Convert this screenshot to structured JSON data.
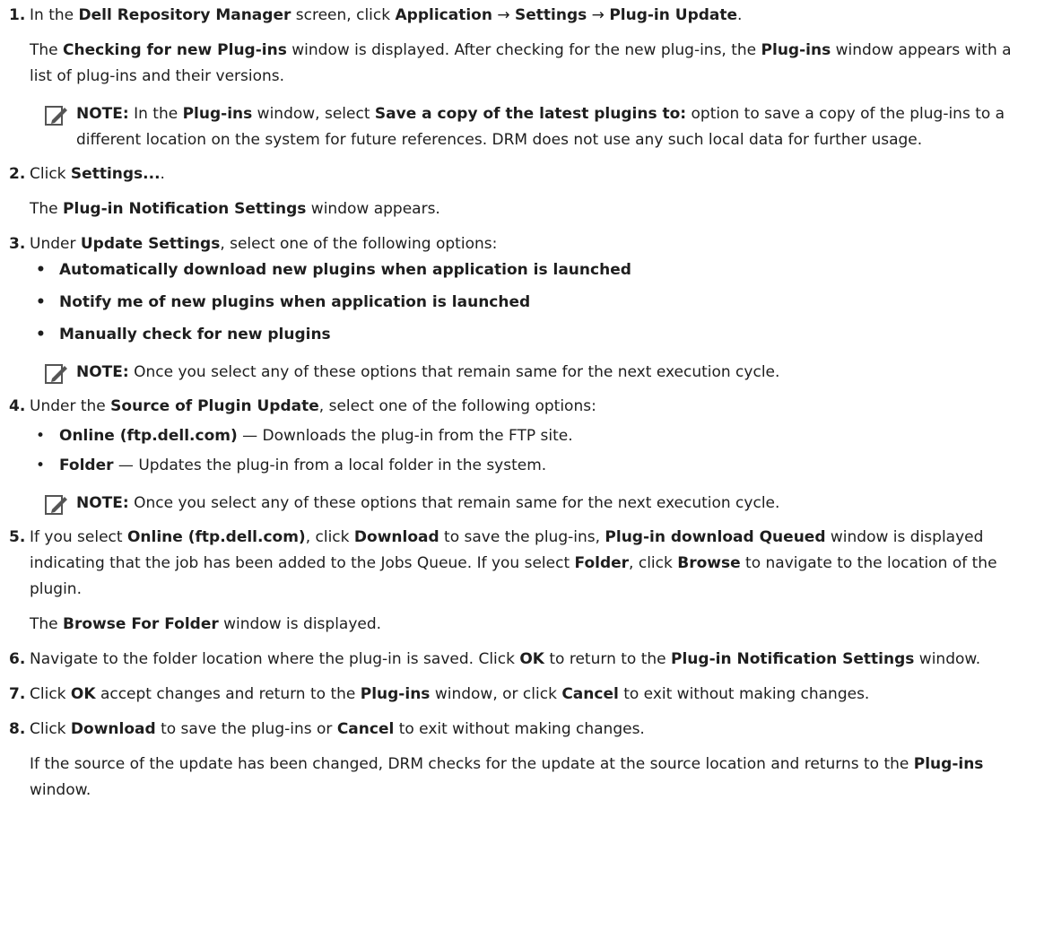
{
  "steps": [
    {
      "num": "1.",
      "line1": [
        "In the ",
        "Dell Repository Manager",
        " screen, click ",
        "Application",
        " → ",
        "Settings",
        " → ",
        "Plug-in Update",
        "."
      ],
      "line2": [
        "The ",
        "Checking for new Plug-ins",
        " window is displayed. After checking for the new plug-ins, the ",
        "Plug-ins",
        " window appears with a list of plug-ins and their versions."
      ],
      "note": [
        "NOTE:",
        " In the ",
        "Plug-ins",
        " window, select ",
        "Save a copy of the latest plugins to:",
        " option to save a copy of the plug-ins to a different location on the system for future references. DRM does not use any such local data for further usage."
      ]
    },
    {
      "num": "2.",
      "line1": [
        "Click ",
        "Settings...",
        "."
      ],
      "line2": [
        "The ",
        "Plug-in Notification Settings",
        " window appears."
      ]
    },
    {
      "num": "3.",
      "line1": [
        "Under ",
        "Update Settings",
        ", select one of the following options:"
      ],
      "bullets": [
        "Automatically download new plugins when application is launched",
        "Notify me of new plugins when application is launched",
        "Manually check for new plugins"
      ],
      "note": [
        "NOTE:",
        " Once you select any of these options that remain same for the next execution cycle."
      ]
    },
    {
      "num": "4.",
      "line1": [
        "Under the ",
        "Source of Plugin Update",
        ", select one of the following options:"
      ],
      "bullets2": [
        [
          "Online (ftp.dell.com)",
          " — Downloads the plug-in from the FTP site."
        ],
        [
          "Folder",
          " — Updates the plug-in from a local folder in the system."
        ]
      ],
      "note": [
        "NOTE:",
        " Once you select any of these options that remain same for the next execution cycle."
      ]
    },
    {
      "num": "5.",
      "line1": [
        "If you select ",
        "Online (ftp.dell.com)",
        ", click ",
        "Download",
        " to save the plug-ins, ",
        "Plug-in download Queued",
        " window is displayed indicating that the job has been added to the Jobs Queue. If you select ",
        "Folder",
        ", click ",
        "Browse",
        " to navigate to the location of the plugin."
      ],
      "line2": [
        "The ",
        "Browse For Folder",
        " window is displayed."
      ]
    },
    {
      "num": "6.",
      "line1": [
        "Navigate to the folder location where the plug-in is saved. Click ",
        "OK",
        " to return to the ",
        "Plug-in Notification Settings",
        " window."
      ]
    },
    {
      "num": "7.",
      "line1": [
        "Click ",
        "OK",
        " accept changes and return to the ",
        "Plug-ins",
        " window, or click ",
        "Cancel",
        " to exit without making changes."
      ]
    },
    {
      "num": "8.",
      "line1": [
        "Click ",
        "Download",
        " to save the plug-ins or ",
        "Cancel",
        " to exit without making changes."
      ],
      "line2": [
        "If the source of the update has been changed, DRM checks for the update at the source location and returns to the ",
        "Plug-ins",
        " window."
      ]
    }
  ],
  "icons": {
    "note": "note-pencil-icon"
  }
}
